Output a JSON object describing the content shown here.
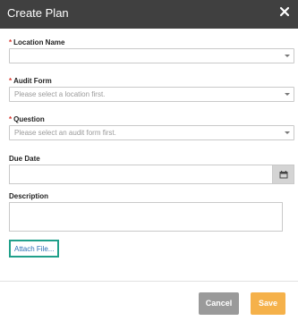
{
  "dialog": {
    "title": "Create Plan",
    "close_icon": "close-icon"
  },
  "fields": {
    "location": {
      "label": "Location Name",
      "required_mark": "*",
      "value": ""
    },
    "audit_form": {
      "label": "Audit Form",
      "required_mark": "*",
      "value": "Please select a location first."
    },
    "question": {
      "label": "Question",
      "required_mark": "*",
      "value": "Please select an audit form first."
    },
    "due_date": {
      "label": "Due Date",
      "value": "",
      "calendar_icon": "calendar-icon"
    },
    "description": {
      "label": "Description",
      "value": ""
    }
  },
  "attach": {
    "label": "Attach File..."
  },
  "footer": {
    "cancel_label": "Cancel",
    "save_label": "Save"
  },
  "colors": {
    "header_bg": "#404040",
    "required": "#d9342b",
    "attach_border": "#20a08a",
    "cancel_bg": "#9a9a9a",
    "save_bg": "#f5b14a"
  }
}
